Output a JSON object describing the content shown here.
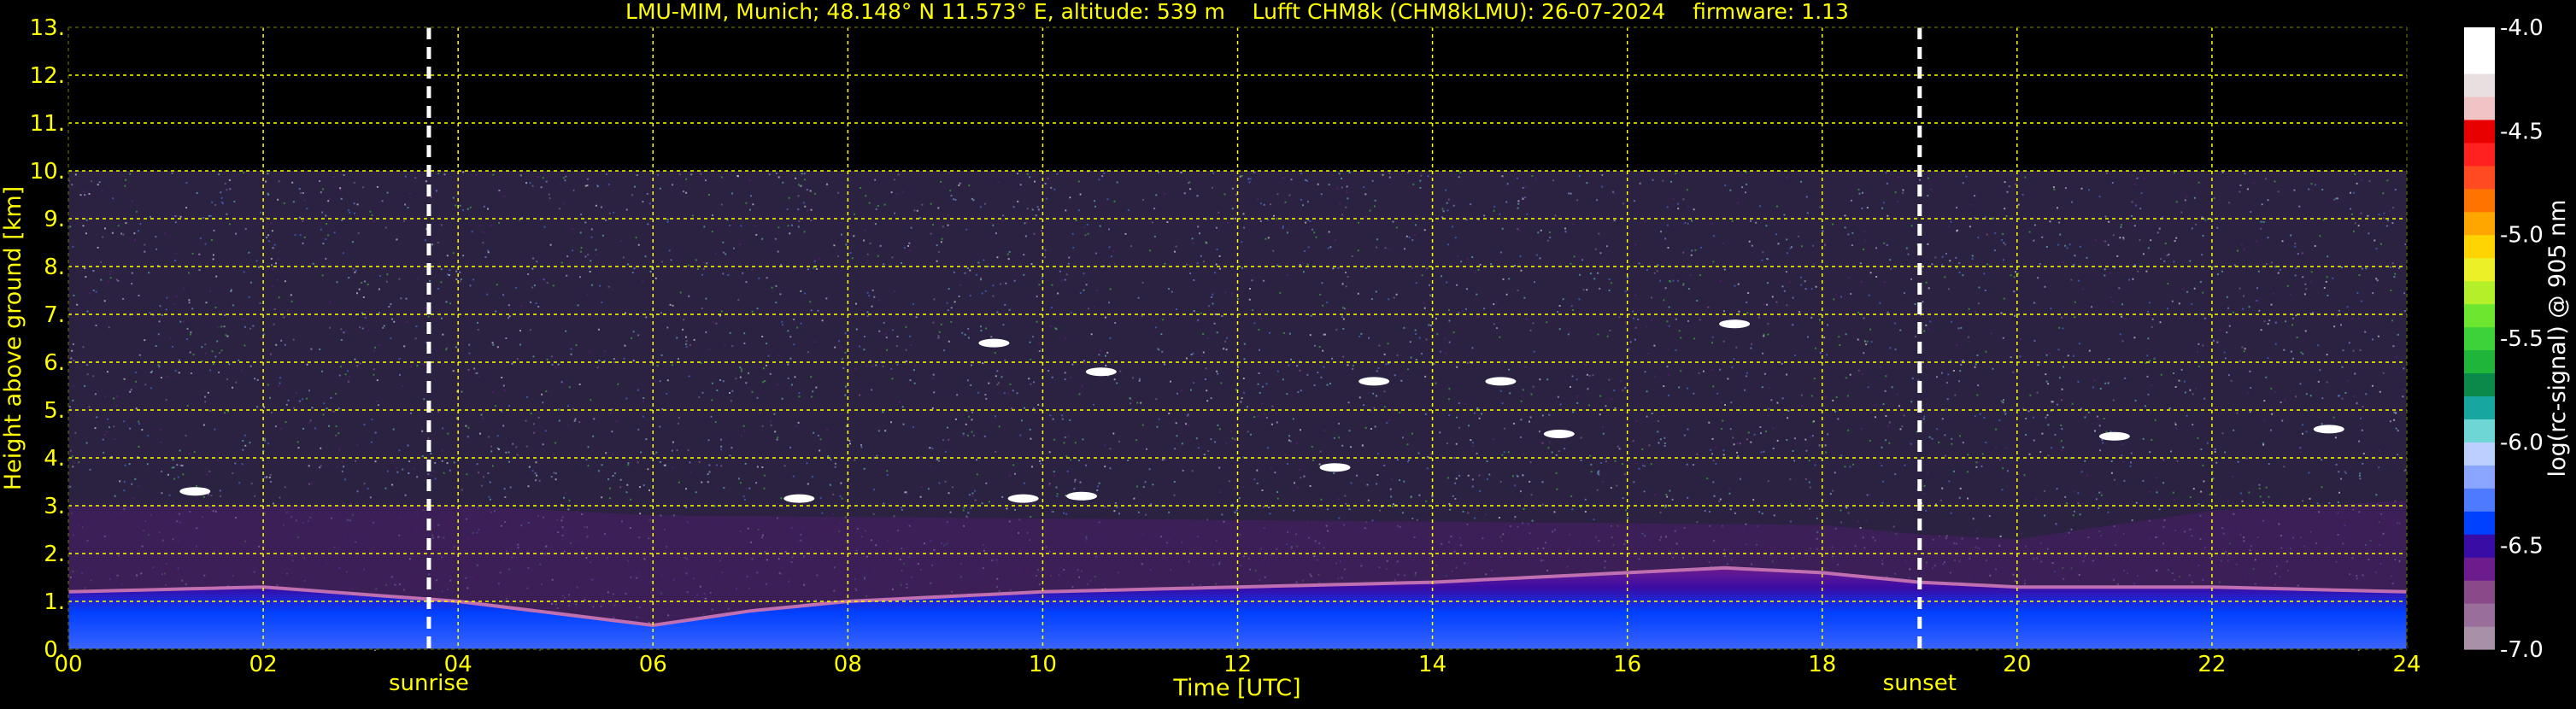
{
  "chart_data": {
    "type": "heatmap",
    "title": "LMU-MIM, Munich; 48.148° N 11.573° E, altitude: 539 m    Lufft CHM8k (CHM8kLMU): 26-07-2024    firmware: 1.13",
    "xlabel": "Time [UTC]",
    "ylabel": "Height above ground [km]",
    "colorbar_label": "log(rc-signal) @ 905 nm",
    "xlim": [
      0,
      24
    ],
    "ylim": [
      0,
      13
    ],
    "x_ticks": [
      "00",
      "02",
      "04",
      "06",
      "08",
      "10",
      "12",
      "14",
      "16",
      "18",
      "20",
      "22",
      "24"
    ],
    "y_ticks": [
      "0.",
      "1.",
      "2.",
      "3.",
      "4.",
      "5.",
      "6.",
      "7.",
      "8.",
      "9.",
      "10.",
      "11.",
      "12.",
      "13."
    ],
    "grid": true,
    "colorbar_range": [
      -7.0,
      -4.0
    ],
    "colorbar_ticks": [
      "-4.0",
      "-4.5",
      "-5.0",
      "-5.5",
      "-6.0",
      "-6.5",
      "-7.0"
    ],
    "colorbar_colors": [
      "#a891a8",
      "#9a6e9a",
      "#8a4a8a",
      "#6c1c8c",
      "#3a0ca6",
      "#0040ff",
      "#4d7aff",
      "#8aa6ff",
      "#bcd0ff",
      "#6fd6d6",
      "#18a6a0",
      "#0a8a4a",
      "#1fb43a",
      "#3ed23a",
      "#6ce62e",
      "#b4f02a",
      "#ecf026",
      "#ffd400",
      "#ffa600",
      "#ff7400",
      "#ff4a22",
      "#ff2020",
      "#e80000",
      "#f0c4c4",
      "#e8e0e0",
      "#ffffff",
      "#ffffff"
    ],
    "range_limit_km": 10.0,
    "events": [
      {
        "label": "sunrise",
        "x": 3.7
      },
      {
        "label": "sunset",
        "x": 19.0
      }
    ],
    "layers": [
      {
        "name": "boundary_layer_top_km",
        "x": [
          0,
          2,
          4,
          6,
          7,
          8,
          10,
          12,
          14,
          16,
          17,
          18,
          19,
          20,
          22,
          24
        ],
        "y": [
          1.2,
          1.3,
          1.0,
          0.5,
          0.8,
          1.0,
          1.2,
          1.3,
          1.4,
          1.6,
          1.7,
          1.6,
          1.4,
          1.3,
          1.3,
          1.2
        ]
      },
      {
        "name": "residual_layer_km",
        "x": [
          0,
          4,
          6,
          18,
          19,
          20,
          22,
          24
        ],
        "y": [
          3.0,
          3.0,
          2.8,
          2.6,
          2.4,
          2.3,
          2.9,
          3.1
        ]
      }
    ],
    "clouds": [
      {
        "t": 1.3,
        "h": 3.3
      },
      {
        "t": 7.5,
        "h": 3.15
      },
      {
        "t": 9.8,
        "h": 3.15
      },
      {
        "t": 10.4,
        "h": 3.2
      },
      {
        "t": 9.5,
        "h": 6.4
      },
      {
        "t": 10.6,
        "h": 5.8
      },
      {
        "t": 13.0,
        "h": 3.8
      },
      {
        "t": 13.4,
        "h": 5.6
      },
      {
        "t": 14.7,
        "h": 5.6
      },
      {
        "t": 15.3,
        "h": 4.5
      },
      {
        "t": 17.1,
        "h": 6.8
      },
      {
        "t": 21.0,
        "h": 4.45
      },
      {
        "t": 23.2,
        "h": 4.6
      }
    ],
    "palette": {
      "text": "#ffff00",
      "grid": "#ffff00",
      "background": "#000000",
      "event_line": "#ffffff"
    }
  }
}
